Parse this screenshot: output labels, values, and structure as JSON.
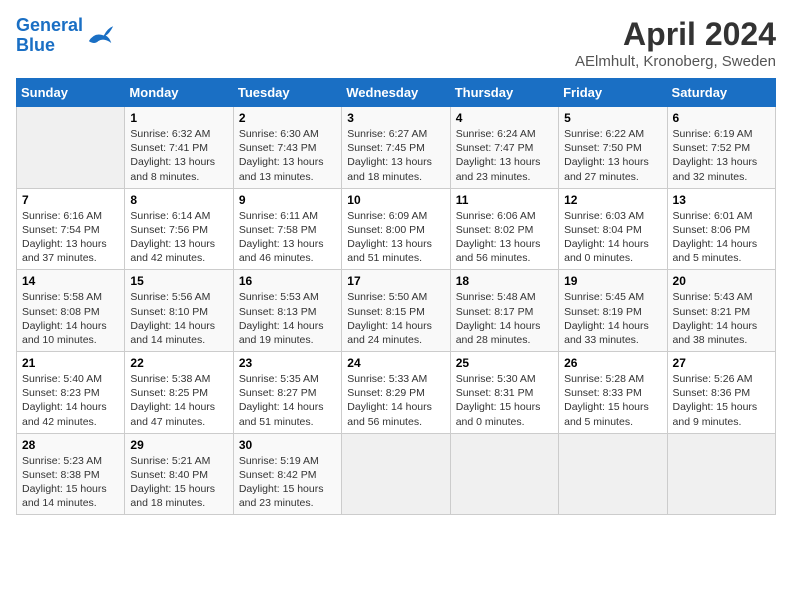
{
  "header": {
    "logo_line1": "General",
    "logo_line2": "Blue",
    "title": "April 2024",
    "subtitle": "AElmhult, Kronoberg, Sweden"
  },
  "weekdays": [
    "Sunday",
    "Monday",
    "Tuesday",
    "Wednesday",
    "Thursday",
    "Friday",
    "Saturday"
  ],
  "weeks": [
    [
      {
        "day": "",
        "info": ""
      },
      {
        "day": "1",
        "info": "Sunrise: 6:32 AM\nSunset: 7:41 PM\nDaylight: 13 hours\nand 8 minutes."
      },
      {
        "day": "2",
        "info": "Sunrise: 6:30 AM\nSunset: 7:43 PM\nDaylight: 13 hours\nand 13 minutes."
      },
      {
        "day": "3",
        "info": "Sunrise: 6:27 AM\nSunset: 7:45 PM\nDaylight: 13 hours\nand 18 minutes."
      },
      {
        "day": "4",
        "info": "Sunrise: 6:24 AM\nSunset: 7:47 PM\nDaylight: 13 hours\nand 23 minutes."
      },
      {
        "day": "5",
        "info": "Sunrise: 6:22 AM\nSunset: 7:50 PM\nDaylight: 13 hours\nand 27 minutes."
      },
      {
        "day": "6",
        "info": "Sunrise: 6:19 AM\nSunset: 7:52 PM\nDaylight: 13 hours\nand 32 minutes."
      }
    ],
    [
      {
        "day": "7",
        "info": "Sunrise: 6:16 AM\nSunset: 7:54 PM\nDaylight: 13 hours\nand 37 minutes."
      },
      {
        "day": "8",
        "info": "Sunrise: 6:14 AM\nSunset: 7:56 PM\nDaylight: 13 hours\nand 42 minutes."
      },
      {
        "day": "9",
        "info": "Sunrise: 6:11 AM\nSunset: 7:58 PM\nDaylight: 13 hours\nand 46 minutes."
      },
      {
        "day": "10",
        "info": "Sunrise: 6:09 AM\nSunset: 8:00 PM\nDaylight: 13 hours\nand 51 minutes."
      },
      {
        "day": "11",
        "info": "Sunrise: 6:06 AM\nSunset: 8:02 PM\nDaylight: 13 hours\nand 56 minutes."
      },
      {
        "day": "12",
        "info": "Sunrise: 6:03 AM\nSunset: 8:04 PM\nDaylight: 14 hours\nand 0 minutes."
      },
      {
        "day": "13",
        "info": "Sunrise: 6:01 AM\nSunset: 8:06 PM\nDaylight: 14 hours\nand 5 minutes."
      }
    ],
    [
      {
        "day": "14",
        "info": "Sunrise: 5:58 AM\nSunset: 8:08 PM\nDaylight: 14 hours\nand 10 minutes."
      },
      {
        "day": "15",
        "info": "Sunrise: 5:56 AM\nSunset: 8:10 PM\nDaylight: 14 hours\nand 14 minutes."
      },
      {
        "day": "16",
        "info": "Sunrise: 5:53 AM\nSunset: 8:13 PM\nDaylight: 14 hours\nand 19 minutes."
      },
      {
        "day": "17",
        "info": "Sunrise: 5:50 AM\nSunset: 8:15 PM\nDaylight: 14 hours\nand 24 minutes."
      },
      {
        "day": "18",
        "info": "Sunrise: 5:48 AM\nSunset: 8:17 PM\nDaylight: 14 hours\nand 28 minutes."
      },
      {
        "day": "19",
        "info": "Sunrise: 5:45 AM\nSunset: 8:19 PM\nDaylight: 14 hours\nand 33 minutes."
      },
      {
        "day": "20",
        "info": "Sunrise: 5:43 AM\nSunset: 8:21 PM\nDaylight: 14 hours\nand 38 minutes."
      }
    ],
    [
      {
        "day": "21",
        "info": "Sunrise: 5:40 AM\nSunset: 8:23 PM\nDaylight: 14 hours\nand 42 minutes."
      },
      {
        "day": "22",
        "info": "Sunrise: 5:38 AM\nSunset: 8:25 PM\nDaylight: 14 hours\nand 47 minutes."
      },
      {
        "day": "23",
        "info": "Sunrise: 5:35 AM\nSunset: 8:27 PM\nDaylight: 14 hours\nand 51 minutes."
      },
      {
        "day": "24",
        "info": "Sunrise: 5:33 AM\nSunset: 8:29 PM\nDaylight: 14 hours\nand 56 minutes."
      },
      {
        "day": "25",
        "info": "Sunrise: 5:30 AM\nSunset: 8:31 PM\nDaylight: 15 hours\nand 0 minutes."
      },
      {
        "day": "26",
        "info": "Sunrise: 5:28 AM\nSunset: 8:33 PM\nDaylight: 15 hours\nand 5 minutes."
      },
      {
        "day": "27",
        "info": "Sunrise: 5:26 AM\nSunset: 8:36 PM\nDaylight: 15 hours\nand 9 minutes."
      }
    ],
    [
      {
        "day": "28",
        "info": "Sunrise: 5:23 AM\nSunset: 8:38 PM\nDaylight: 15 hours\nand 14 minutes."
      },
      {
        "day": "29",
        "info": "Sunrise: 5:21 AM\nSunset: 8:40 PM\nDaylight: 15 hours\nand 18 minutes."
      },
      {
        "day": "30",
        "info": "Sunrise: 5:19 AM\nSunset: 8:42 PM\nDaylight: 15 hours\nand 23 minutes."
      },
      {
        "day": "",
        "info": ""
      },
      {
        "day": "",
        "info": ""
      },
      {
        "day": "",
        "info": ""
      },
      {
        "day": "",
        "info": ""
      }
    ]
  ]
}
